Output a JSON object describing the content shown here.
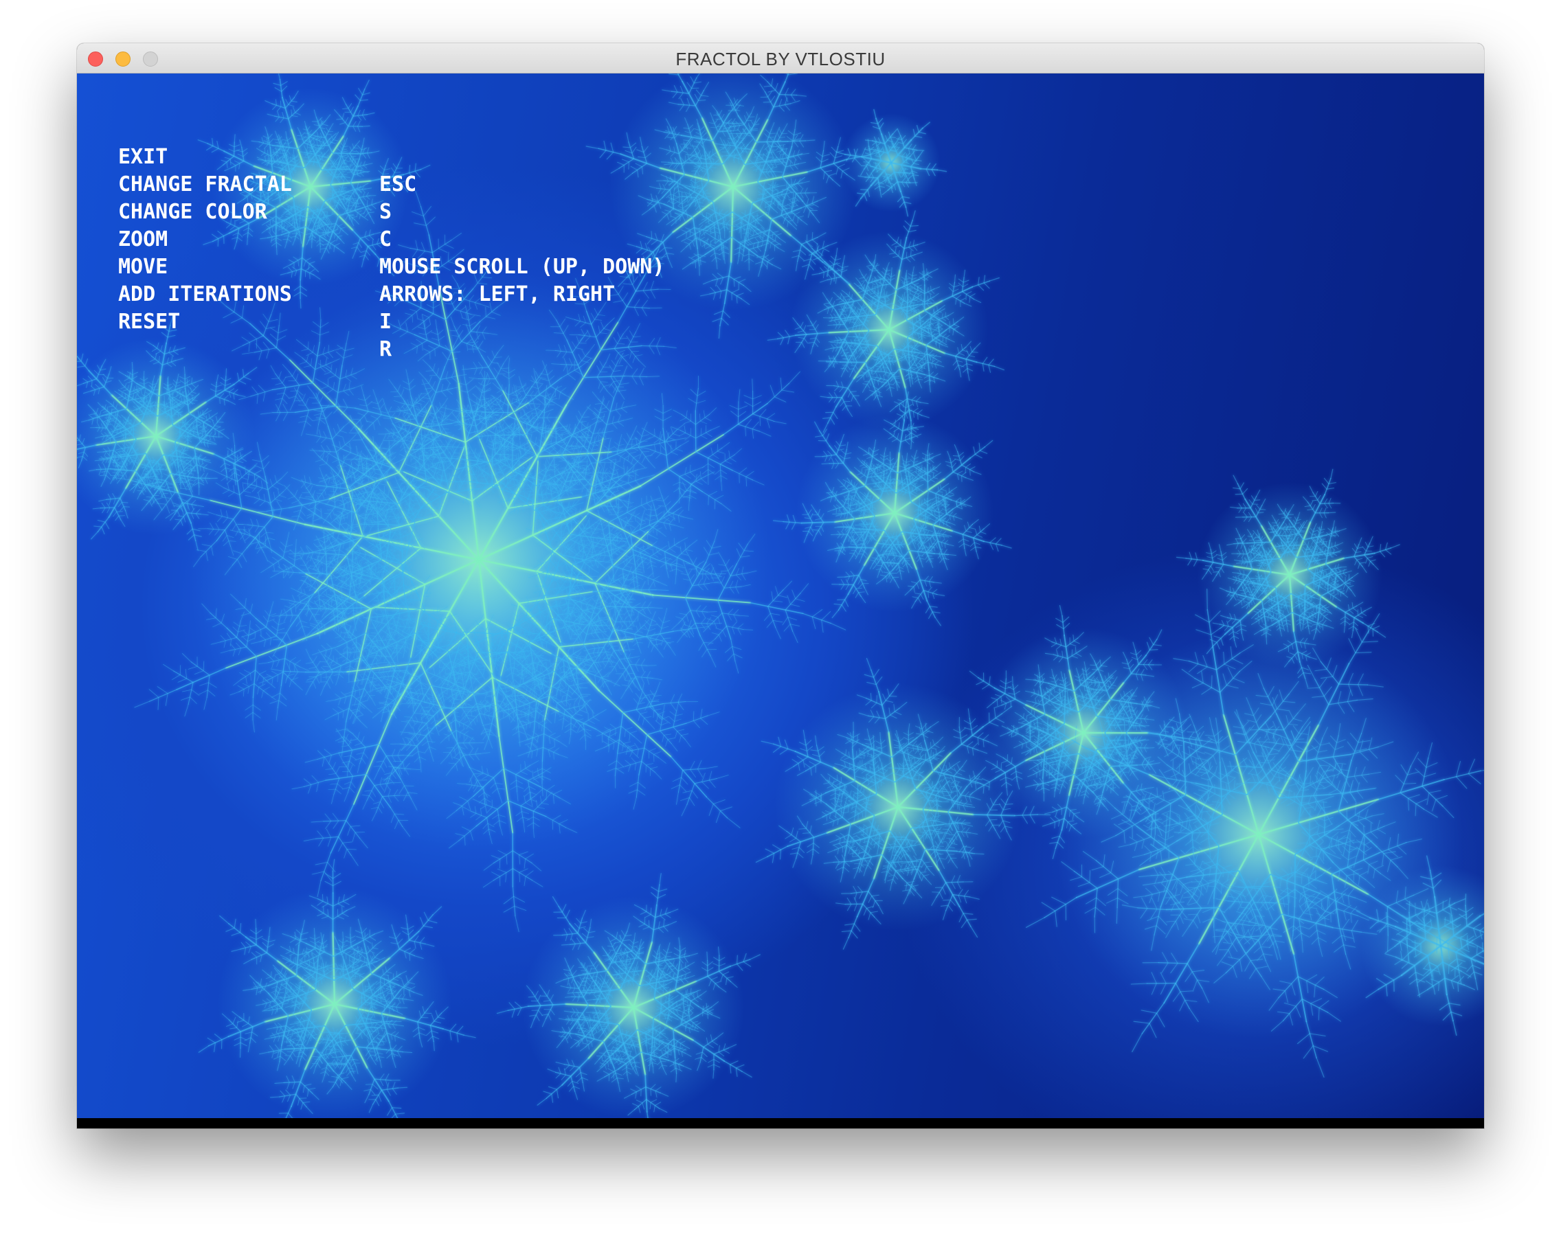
{
  "window": {
    "title": "FRACTOL BY VTLOSTIU",
    "controls": [
      "close-icon",
      "minimize-icon",
      "zoom-icon"
    ]
  },
  "colors": {
    "fractal_highlight": "#7ff0c0",
    "fractal_mid": "#3cb8f0",
    "background_deep": "#071d7c",
    "background_light": "#2f86f0",
    "hud_text": "#ffffff"
  },
  "hud": {
    "rows": [
      {
        "action": "EXIT",
        "key": "ESC"
      },
      {
        "action": "CHANGE FRACTAL",
        "key": "S"
      },
      {
        "action": "CHANGE COLOR",
        "key": "C"
      },
      {
        "action": "ZOOM",
        "key": "MOUSE SCROLL (UP, DOWN)"
      },
      {
        "action": "MOVE",
        "key": "ARROWS: LEFT, RIGHT"
      },
      {
        "action": "ADD ITERATIONS",
        "key": "I"
      },
      {
        "action": "RESET",
        "key": "R"
      }
    ]
  }
}
